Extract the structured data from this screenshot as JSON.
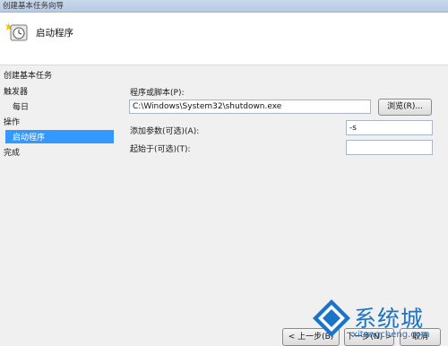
{
  "window": {
    "title": "创建基本任务向导"
  },
  "header": {
    "title": "启动程序"
  },
  "sidebar": {
    "items": [
      {
        "label": "创建基本任务"
      },
      {
        "label": "触发器"
      },
      {
        "label": "每日"
      },
      {
        "label": "操作"
      },
      {
        "label": "启动程序"
      },
      {
        "label": "完成"
      }
    ]
  },
  "form": {
    "program_label": "程序或脚本(P):",
    "program_value": "C:\\Windows\\System32\\shutdown.exe",
    "browse_label": "浏览(R)...",
    "args_label": "添加参数(可选)(A):",
    "args_value": "-s",
    "startin_label": "起始于(可选)(T):",
    "startin_value": ""
  },
  "footer": {
    "back_label": "< 上一步(B)",
    "next_label": "下一步(N) >",
    "cancel_label": "取消"
  },
  "watermark": {
    "text": "系统城",
    "url": "xitongcheng.com"
  },
  "colors": {
    "selection": "#3399ff",
    "watermark": "#1b74c8"
  }
}
